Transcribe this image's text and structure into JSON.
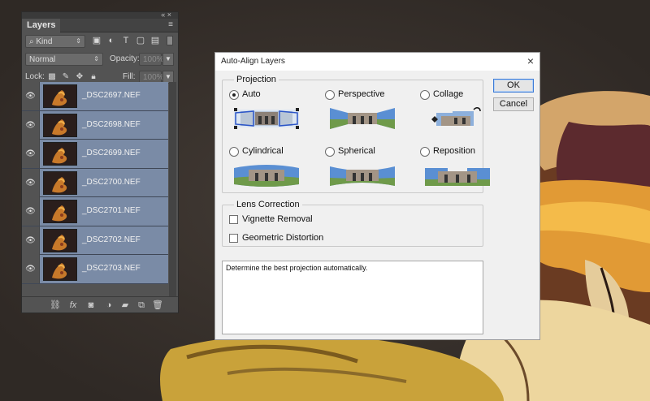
{
  "layers_panel": {
    "tab_label": "Layers",
    "filter_kind": "Kind",
    "blend_mode": "Normal",
    "opacity_label": "Opacity:",
    "opacity_value": "100%",
    "lock_label": "Lock:",
    "fill_label": "Fill:",
    "fill_value": "100%",
    "layers": [
      {
        "name": "_DSC2697.NEF"
      },
      {
        "name": "_DSC2698.NEF"
      },
      {
        "name": "_DSC2699.NEF"
      },
      {
        "name": "_DSC2700.NEF"
      },
      {
        "name": "_DSC2701.NEF"
      },
      {
        "name": "_DSC2702.NEF"
      },
      {
        "name": "_DSC2703.NEF"
      }
    ],
    "filter_icons": [
      "pixel-filter-icon",
      "adjustment-filter-icon",
      "type-filter-icon",
      "shape-filter-icon",
      "smart-object-filter-icon"
    ],
    "lock_icons": [
      "lock-transparent-icon",
      "lock-paint-icon",
      "lock-position-icon",
      "lock-all-icon"
    ],
    "footer_icons": [
      "link-icon",
      "fx-icon",
      "mask-icon",
      "adjustment-icon",
      "group-folder-icon",
      "new-layer-icon",
      "trash-icon"
    ]
  },
  "dialog": {
    "title": "Auto-Align Layers",
    "projection_legend": "Projection",
    "options": [
      {
        "label": "Auto",
        "selected": true
      },
      {
        "label": "Perspective",
        "selected": false
      },
      {
        "label": "Collage",
        "selected": false
      },
      {
        "label": "Cylindrical",
        "selected": false
      },
      {
        "label": "Spherical",
        "selected": false
      },
      {
        "label": "Reposition",
        "selected": false
      }
    ],
    "lens_legend": "Lens Correction",
    "vignette_label": "Vignette Removal",
    "vignette_checked": false,
    "distortion_label": "Geometric Distortion",
    "distortion_checked": false,
    "ok_label": "OK",
    "cancel_label": "Cancel",
    "description": "Determine the best projection automatically."
  }
}
